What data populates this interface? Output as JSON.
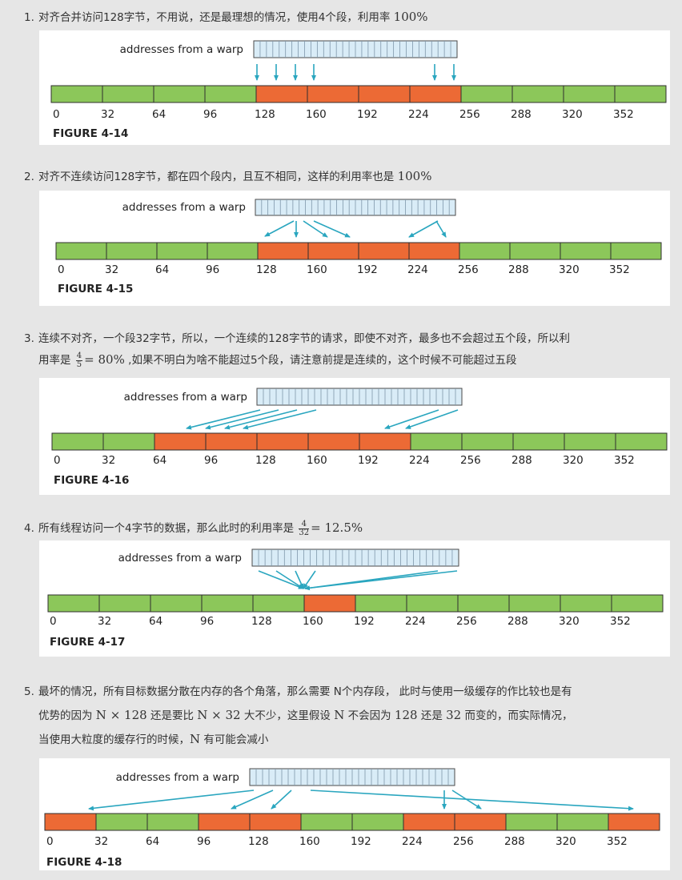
{
  "common": {
    "warp_label": "addresses from a warp",
    "tick_labels": [
      "0",
      "32",
      "64",
      "96",
      "128",
      "160",
      "192",
      "224",
      "256",
      "288",
      "320",
      "352"
    ],
    "colors": {
      "green": "#8cc75a",
      "orange": "#ec6a35",
      "warp_fill": "#d9ecf7",
      "arrow": "#2aa6bf",
      "outline": "#2f2f2f"
    }
  },
  "items": [
    {
      "number": "1.",
      "text": "对齐合并访问128字节，不用说，还是最理想的情况，使用4个段，利用率 ",
      "math": "100%",
      "figure": {
        "caption": "FIGURE 4-14",
        "highlighted_segments": [
          4,
          5,
          6,
          7
        ]
      }
    },
    {
      "number": "2.",
      "text": "对齐不连续访问128字节，都在四个段内，且互不相同，这样的利用率也是 ",
      "math": "100%",
      "figure": {
        "caption": "FIGURE 4-15",
        "highlighted_segments": [
          4,
          5,
          6,
          7
        ]
      }
    },
    {
      "number": "3.",
      "text_line1": "连续不对齐，一个段32字节，所以，一个连续的128字节的请求，即使不对齐，最多也不会超过五个段，所以利",
      "text_line2_a": "用率是 ",
      "frac_num": "4",
      "frac_den": "5",
      "math": "= 80%",
      "text_line2_b": " ,如果不明白为啥不能超过5个段，请注意前提是连续的，这个时候不可能超过五段",
      "figure": {
        "caption": "FIGURE 4-16",
        "highlighted_segments": [
          2,
          3,
          4,
          5,
          6
        ]
      }
    },
    {
      "number": "4.",
      "text": "所有线程访问一个4字节的数据，那么此时的利用率是 ",
      "frac_num": "4",
      "frac_den": "32",
      "math": "= 12.5%",
      "figure": {
        "caption": "FIGURE 4-17",
        "highlighted_segments": [
          5
        ]
      }
    },
    {
      "number": "5.",
      "line1": "最坏的情况，所有目标数据分散在内存的各个角落，那么需要 N个内存段， 此时与使用一级缓存的作比较也是有",
      "line2_a": "优势的因为 ",
      "line2_m1": "N × 128",
      "line2_b": " 还是要比 ",
      "line2_m2": "N × 32",
      "line2_c": " 大不少，这里假设 ",
      "line2_m3": "N",
      "line2_d": " 不会因为 ",
      "line2_m4": "128",
      "line2_e": " 还是 ",
      "line2_m5": "32",
      "line2_f": " 而变的，而实际情况，",
      "line3_a": "当使用大粒度的缓存行的时候，",
      "line3_m": "N",
      "line3_b": " 有可能会减小",
      "figure": {
        "caption": "FIGURE 4-18",
        "highlighted_segments": [
          0,
          3,
          4,
          7,
          8,
          11
        ]
      }
    }
  ]
}
